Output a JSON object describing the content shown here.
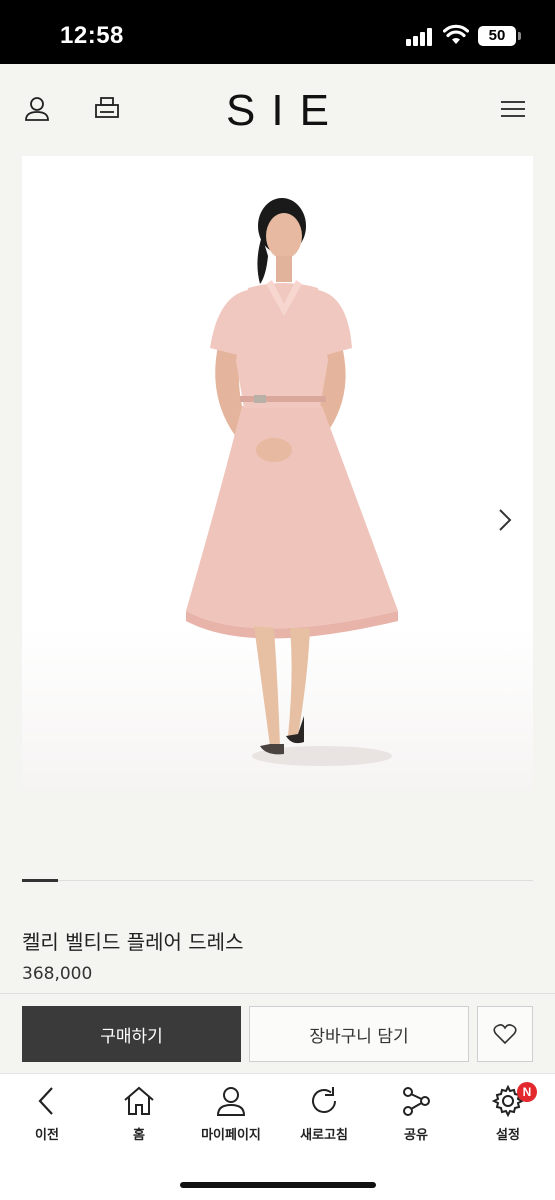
{
  "status_bar": {
    "time": "12:58",
    "battery": "50"
  },
  "header": {
    "logo": "SIE",
    "icons": [
      "user-icon",
      "printer-icon",
      "menu-icon"
    ]
  },
  "product": {
    "name": "켈리 벨티드 플레어 드레스",
    "price": "368,000",
    "image_alt": "pink belted flare dress worn by model",
    "dress_color": "#f0c8c0"
  },
  "actions": {
    "buy_label": "구매하기",
    "cart_label": "장바구니 담기"
  },
  "bottom_nav": {
    "items": [
      {
        "label": "이전",
        "icon": "back-icon"
      },
      {
        "label": "홈",
        "icon": "home-icon"
      },
      {
        "label": "마이페이지",
        "icon": "user-icon"
      },
      {
        "label": "새로고침",
        "icon": "refresh-icon"
      },
      {
        "label": "공유",
        "icon": "share-icon"
      },
      {
        "label": "설정",
        "icon": "settings-icon"
      }
    ],
    "badge": "N"
  },
  "colors": {
    "accent_dark": "#3a3a3a",
    "badge": "#e3282e",
    "background": "#f4f4f0"
  }
}
